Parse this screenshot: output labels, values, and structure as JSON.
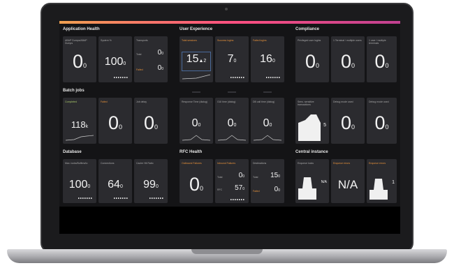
{
  "sections": {
    "app_health": "Application Health",
    "user_experience": "User Experience",
    "compliance": "Compliance",
    "batch_jobs": "Batch jobs",
    "database": "Database",
    "rfc_health": "RFC Health",
    "central_instance": "Central instance"
  },
  "app_health": [
    {
      "title": "ABAP Dumps/ABAP Dumps",
      "value": "0",
      "sub": "0"
    },
    {
      "title": "System %",
      "value": "100",
      "sub": "0"
    },
    {
      "title": "Transports",
      "rows": [
        {
          "label": "Total",
          "value": "0",
          "sub": "0"
        },
        {
          "label": "Failed",
          "value": "0",
          "sub": "0"
        }
      ]
    }
  ],
  "user_experience": [
    {
      "title": "Total sessions",
      "value": "15",
      "sub": "2",
      "arrow": "▲"
    },
    {
      "title": "Success logins",
      "value": "7",
      "sub": "0"
    },
    {
      "title": "Failed logins",
      "value": "16",
      "sub": "0"
    }
  ],
  "compliance": [
    {
      "title": "Privileged user logins",
      "value": "0",
      "sub": "0"
    },
    {
      "title": "1 Terminal / multiple users",
      "value": "0",
      "sub": "0"
    },
    {
      "title": "1 user / multiple terminals",
      "value": "0",
      "sub": "0"
    }
  ],
  "batch_jobs": [
    {
      "title": "Completed",
      "value": "118",
      "sub": "k"
    },
    {
      "title": "Failed",
      "value": "0",
      "sub": "0"
    },
    {
      "title": "Job delay",
      "value": "0",
      "sub": "0"
    }
  ],
  "ux_row2": [
    {
      "title": "Response Time (dialog)",
      "value": "0",
      "sub": "0"
    },
    {
      "title": "GUI time (dialog)",
      "value": "0",
      "sub": "0"
    },
    {
      "title": "DB call time (dialog)",
      "value": "0",
      "sub": "0"
    }
  ],
  "compliance_row2": [
    {
      "title": "Sens. sensitive transactions",
      "value": "5",
      "sub": ""
    },
    {
      "title": "Debug mode used",
      "value": "0",
      "sub": "0"
    },
    {
      "title": "Debug mode used",
      "value": "0",
      "sub": "0"
    }
  ],
  "database": [
    {
      "title": "Max. locks/Buffers/to",
      "value": "100",
      "sub": "0"
    },
    {
      "title": "Connections",
      "value": "64",
      "sub": "0"
    },
    {
      "title": "Cache Hit Ratio",
      "value": "99",
      "sub": "0"
    }
  ],
  "rfc_health": [
    {
      "title": "Outbound Failures",
      "value": "0",
      "sub": "0"
    },
    {
      "title": "Inbound Failures",
      "rows": [
        {
          "label": "Total",
          "value": "0",
          "sub": "0"
        },
        {
          "label": "RFC",
          "value": "57",
          "sub": "0"
        }
      ]
    },
    {
      "title": "Destinations",
      "rows": [
        {
          "label": "Total",
          "value": "15",
          "sub": "0"
        },
        {
          "label": "Failed",
          "value": "0",
          "sub": "0"
        }
      ]
    }
  ],
  "central_instance": [
    {
      "title": "Enqueue locks",
      "value": "N/A",
      "sub": ""
    },
    {
      "title": "Enqueue errors",
      "value": "N/A",
      "sub": ""
    },
    {
      "title": "Enqueue errors",
      "value": "1",
      "sub": ""
    }
  ]
}
